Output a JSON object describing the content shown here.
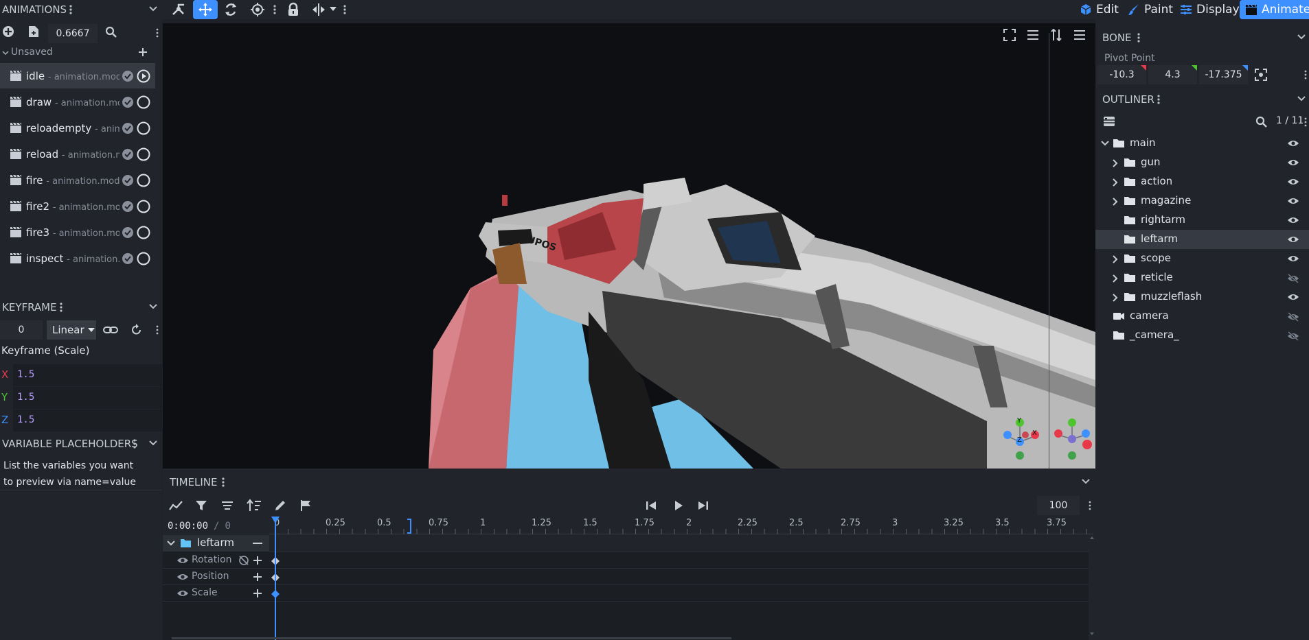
{
  "colors": {
    "bg": "#1e2127",
    "panel": "#21252b",
    "viewport": "#0d0f12",
    "accent": "#3e90ff",
    "selected_row": "#353a43",
    "x_axis": "#e8394a",
    "y_axis": "#4ec42f",
    "z_axis": "#3e90ff"
  },
  "toolbar": {
    "tools": [
      "pivot-tool-icon",
      "move-tool-icon",
      "rotate-tool-icon",
      "target-icon",
      "lock-icon",
      "mirror-icon"
    ],
    "modes": [
      {
        "label": "Edit",
        "icon": "cube-icon",
        "active": false
      },
      {
        "label": "Paint",
        "icon": "brush-icon",
        "active": false
      },
      {
        "label": "Display",
        "icon": "sliders-icon",
        "active": false
      },
      {
        "label": "Animate",
        "icon": "clapper-icon",
        "active": true
      }
    ]
  },
  "animations": {
    "title": "ANIMATIONS",
    "length_value": "0.6667",
    "group_label": "Unsaved",
    "items": [
      {
        "name": "idle",
        "file": "- animation.mode",
        "selected": true
      },
      {
        "name": "draw",
        "file": "- animation.mod",
        "selected": false
      },
      {
        "name": "reloadempty",
        "file": "- animat",
        "selected": false
      },
      {
        "name": "reload",
        "file": "- animation.mc",
        "selected": false
      },
      {
        "name": "fire",
        "file": "- animation.model",
        "selected": false
      },
      {
        "name": "fire2",
        "file": "- animation.mode",
        "selected": false
      },
      {
        "name": "fire3",
        "file": "- animation.mode",
        "selected": false
      },
      {
        "name": "inspect",
        "file": "- animation.m",
        "selected": false
      }
    ]
  },
  "keyframe": {
    "title": "KEYFRAME",
    "time_value": "0",
    "interpolation": "Linear",
    "section_label": "Keyframe (Scale)",
    "axes": [
      {
        "axis": "X",
        "value": "1.5"
      },
      {
        "axis": "Y",
        "value": "1.5"
      },
      {
        "axis": "Z",
        "value": "1.5"
      }
    ]
  },
  "variables": {
    "title": "VARIABLE PLACEHOLDERS",
    "hint": "List the variables you want to preview via name=value"
  },
  "bone": {
    "title": "BONE",
    "pivot_label": "Pivot Point",
    "pivot": [
      "-10.3",
      "4.3",
      "-17.375"
    ]
  },
  "outliner": {
    "title": "OUTLINER",
    "count": "1 / 11",
    "items": [
      {
        "label": "main",
        "depth": 0,
        "expanded": true,
        "chevron": true,
        "type": "folder",
        "visible": true
      },
      {
        "label": "gun",
        "depth": 1,
        "chevron": true,
        "type": "folder",
        "visible": true
      },
      {
        "label": "action",
        "depth": 1,
        "chevron": true,
        "type": "folder",
        "visible": true
      },
      {
        "label": "magazine",
        "depth": 1,
        "chevron": true,
        "type": "folder",
        "visible": true
      },
      {
        "label": "rightarm",
        "depth": 1,
        "chevron": false,
        "type": "folder",
        "visible": true
      },
      {
        "label": "leftarm",
        "depth": 1,
        "chevron": false,
        "type": "folder",
        "visible": true,
        "selected": true
      },
      {
        "label": "scope",
        "depth": 1,
        "chevron": true,
        "type": "folder",
        "visible": true
      },
      {
        "label": "reticle",
        "depth": 1,
        "chevron": true,
        "type": "folder",
        "visible": false
      },
      {
        "label": "muzzleflash",
        "depth": 1,
        "chevron": true,
        "type": "folder",
        "visible": true
      },
      {
        "label": "camera",
        "depth": 0,
        "chevron": false,
        "type": "camera",
        "visible": false
      },
      {
        "label": "_camera_",
        "depth": 0,
        "chevron": false,
        "type": "folder",
        "visible": false
      }
    ]
  },
  "timeline": {
    "title": "TIMELINE",
    "timecode": "0:00:00",
    "frame_sep": "/",
    "frame": "0",
    "speed": "100",
    "ruler": [
      "0",
      "0.25",
      "0.5",
      "0.75",
      "1",
      "1.25",
      "1.5",
      "1.75",
      "2",
      "2.25",
      "2.5",
      "2.75",
      "3",
      "3.25",
      "3.5",
      "3.75"
    ],
    "group": "leftarm",
    "channels": [
      "Rotation",
      "Position",
      "Scale"
    ]
  },
  "viewport": {
    "gizmo_labels": [
      "Y",
      "X",
      "Z"
    ],
    "model_text": "SUPOS"
  }
}
